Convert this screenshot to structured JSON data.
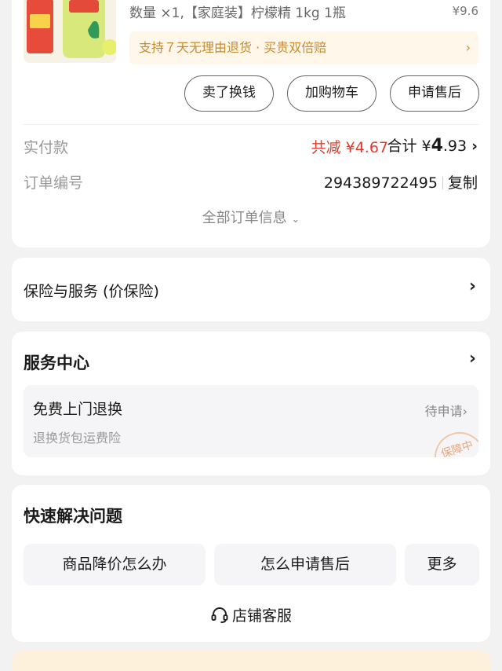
{
  "order": {
    "quantity_text": "数量 ×1,【家庭装】柠檬精 1kg 1瓶",
    "price": "¥9.6",
    "return_notice": "支持７天无理由退货 · 买贵双倍赔",
    "buttons": {
      "sell": "卖了换钱",
      "add_cart": "加购物车",
      "after_sale": "申请售后"
    },
    "paid_label": "实付款",
    "reduce_text": "共减 ¥4.67",
    "total_prefix": "合计 ¥",
    "total_int": "4",
    "total_dec": ".93",
    "order_no_label": "订单编号",
    "order_no": "294389722495",
    "copy": "复制",
    "all_info": "全部订单信息"
  },
  "insurance": {
    "title": "保险与服务 (价保险)"
  },
  "service_center": {
    "title": "服务中心",
    "item_name": "免费上门退换",
    "item_sub": "退换货包运费险",
    "item_status": "待申请",
    "stamp": "保障中"
  },
  "quick": {
    "title": "快速解决问题",
    "btn1": "商品降价怎么办",
    "btn2": "怎么申请售后",
    "btn3": "更多",
    "customer_service": "店铺客服"
  },
  "colors": {
    "accent_red": "#e23b2d",
    "return_gold": "#c98a2c"
  }
}
